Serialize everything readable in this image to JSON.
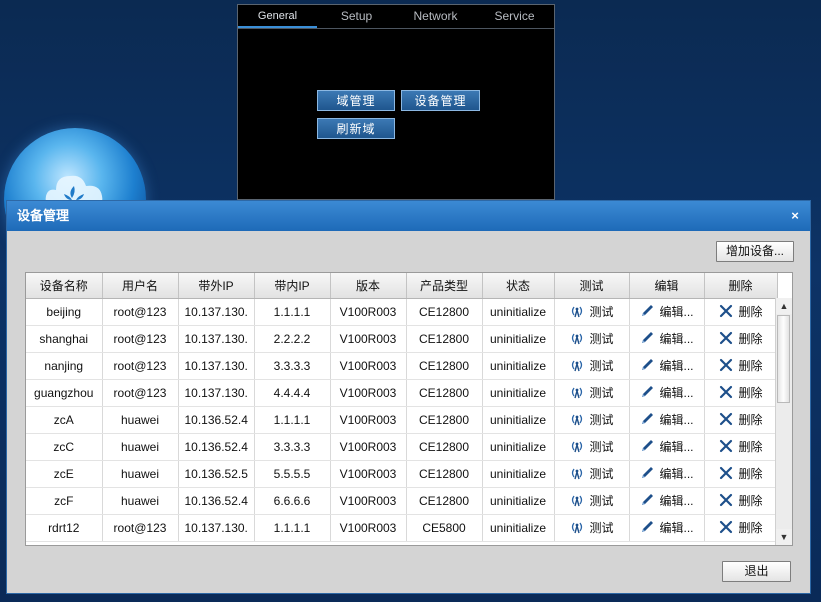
{
  "top_panel": {
    "tabs": [
      "General",
      "Setup",
      "Network",
      "Service"
    ],
    "buttons": {
      "domain_mgmt": "域管理",
      "device_mgmt": "设备管理",
      "refresh_domain": "刷新域"
    }
  },
  "dialog": {
    "title": "设备管理",
    "close_label": "×",
    "add_button": "增加设备...",
    "exit_button": "退出",
    "columns": [
      "设备名称",
      "用户名",
      "带外IP",
      "带内IP",
      "版本",
      "产品类型",
      "状态",
      "测试",
      "编辑",
      "删除"
    ],
    "actions": {
      "test": "测试",
      "edit": "编辑...",
      "delete": "删除"
    },
    "rows": [
      {
        "name": "beijing",
        "user": "root@123",
        "oob_ip": "10.137.130.",
        "inband_ip": "1.1.1.1",
        "version": "V100R003",
        "product": "CE12800",
        "status": "uninitialize"
      },
      {
        "name": "shanghai",
        "user": "root@123",
        "oob_ip": "10.137.130.",
        "inband_ip": "2.2.2.2",
        "version": "V100R003",
        "product": "CE12800",
        "status": "uninitialize"
      },
      {
        "name": "nanjing",
        "user": "root@123",
        "oob_ip": "10.137.130.",
        "inband_ip": "3.3.3.3",
        "version": "V100R003",
        "product": "CE12800",
        "status": "uninitialize"
      },
      {
        "name": "guangzhou",
        "user": "root@123",
        "oob_ip": "10.137.130.",
        "inband_ip": "4.4.4.4",
        "version": "V100R003",
        "product": "CE12800",
        "status": "uninitialize"
      },
      {
        "name": "zcA",
        "user": "huawei",
        "oob_ip": "10.136.52.4",
        "inband_ip": "1.1.1.1",
        "version": "V100R003",
        "product": "CE12800",
        "status": "uninitialize"
      },
      {
        "name": "zcC",
        "user": "huawei",
        "oob_ip": "10.136.52.4",
        "inband_ip": "3.3.3.3",
        "version": "V100R003",
        "product": "CE12800",
        "status": "uninitialize"
      },
      {
        "name": "zcE",
        "user": "huawei",
        "oob_ip": "10.136.52.5",
        "inband_ip": "5.5.5.5",
        "version": "V100R003",
        "product": "CE12800",
        "status": "uninitialize"
      },
      {
        "name": "zcF",
        "user": "huawei",
        "oob_ip": "10.136.52.4",
        "inband_ip": "6.6.6.6",
        "version": "V100R003",
        "product": "CE12800",
        "status": "uninitialize"
      },
      {
        "name": "rdrt12",
        "user": "root@123",
        "oob_ip": "10.137.130.",
        "inband_ip": "1.1.1.1",
        "version": "V100R003",
        "product": "CE5800",
        "status": "uninitialize"
      }
    ],
    "scrollbar": {
      "up_arrow": "▲",
      "down_arrow": "▼"
    }
  },
  "colors": {
    "title_bar": "#2a7ac8",
    "dialog_bg": "#d4d4d4",
    "edit_icon": "#1d4f8a"
  }
}
